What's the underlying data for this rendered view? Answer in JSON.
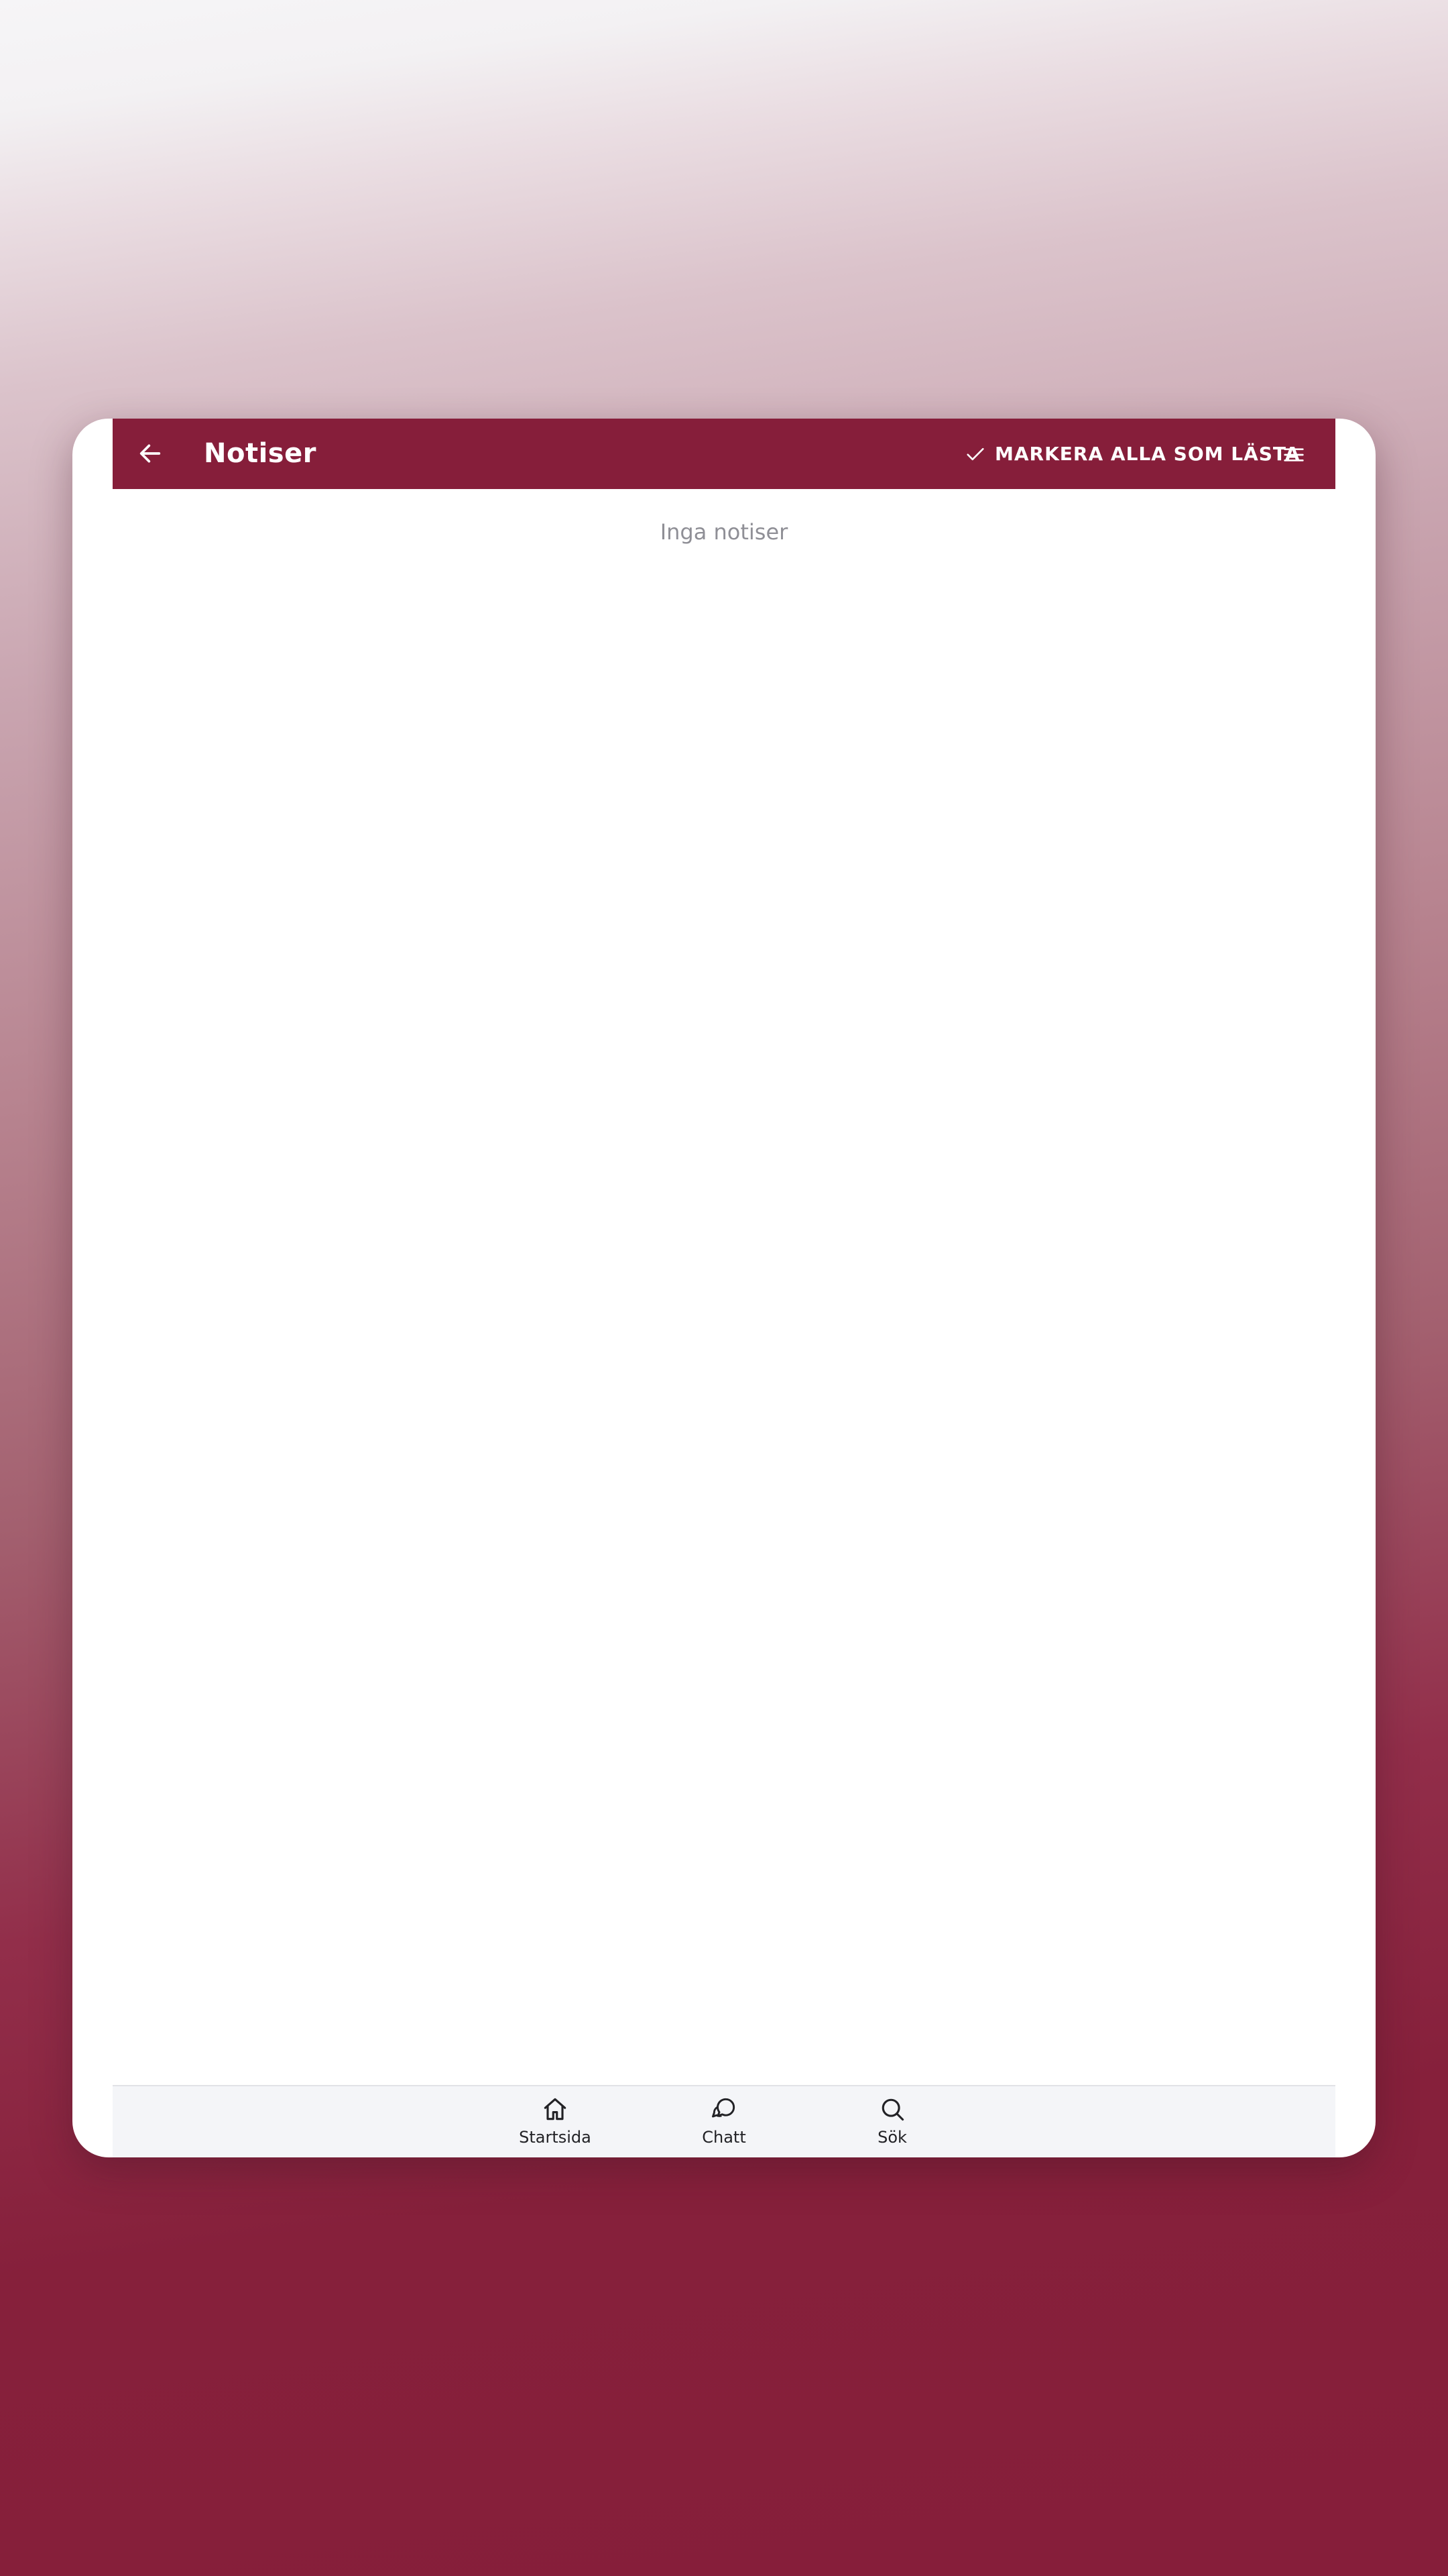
{
  "header": {
    "title": "Notiser",
    "mark_all_label": "MARKERA ALLA SOM LÄSTA"
  },
  "main": {
    "empty_text": "Inga notiser"
  },
  "bottom_nav": {
    "items": [
      {
        "label": "Startsida",
        "icon": "home-icon"
      },
      {
        "label": "Chatt",
        "icon": "chat-icon"
      },
      {
        "label": "Sök",
        "icon": "search-icon"
      }
    ]
  },
  "colors": {
    "brand": "#861e3a",
    "empty_text": "#8f8f96",
    "nav_background": "#f4f5f8"
  }
}
